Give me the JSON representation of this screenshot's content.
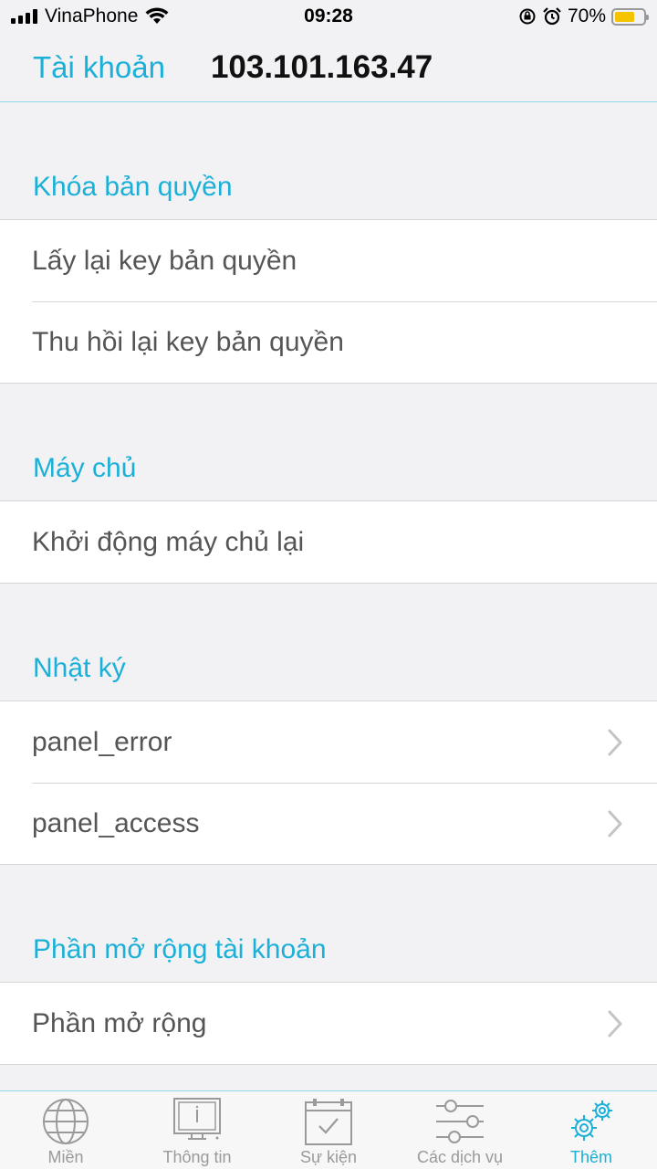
{
  "status_bar": {
    "carrier": "VinaPhone",
    "time": "09:28",
    "battery_percent": "70%",
    "battery_level": 0.7,
    "battery_color": "#f5c400"
  },
  "header": {
    "left_link": "Tài khoản",
    "title": "103.101.163.47"
  },
  "sections": {
    "license": {
      "title": "Khóa bản quyền",
      "items": [
        "Lấy lại key bản quyền",
        "Thu hồi lại key bản quyền"
      ]
    },
    "server": {
      "title": "Máy chủ",
      "items": [
        "Khởi động máy chủ lại"
      ]
    },
    "logs": {
      "title": "Nhật ký",
      "items": [
        "panel_error",
        "panel_access"
      ]
    },
    "extensions": {
      "title": "Phần mở rộng tài khoản",
      "items": [
        "Phần mở rộng"
      ]
    }
  },
  "tab_bar": {
    "tabs": [
      {
        "label": "Miền",
        "icon": "globe-icon"
      },
      {
        "label": "Thông tin",
        "icon": "monitor-icon"
      },
      {
        "label": "Sự kiện",
        "icon": "calendar-check-icon"
      },
      {
        "label": "Các dịch vụ",
        "icon": "sliders-icon"
      },
      {
        "label": "Thêm",
        "icon": "gears-icon"
      }
    ],
    "active": "Thêm"
  },
  "colors": {
    "accent": "#1bb0d8",
    "background": "#f2f2f4",
    "inactive_tab": "#9a9a9a"
  }
}
